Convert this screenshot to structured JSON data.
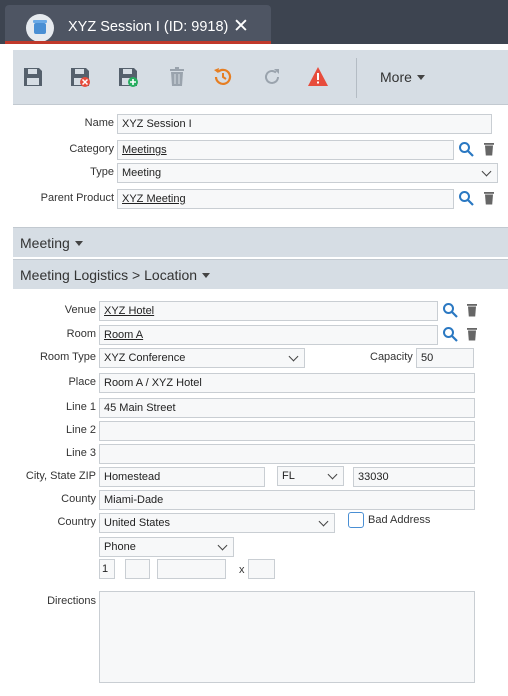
{
  "window": {
    "title": "XYZ Session I (ID: 9918)",
    "close_glyph": "✕"
  },
  "toolbar": {
    "buttons": [
      "save-icon",
      "save-close-icon",
      "save-new-icon",
      "delete-icon",
      "history-icon",
      "refresh-icon",
      "warning-icon"
    ],
    "more_label": "More",
    "colors": {
      "history": "#e67e22",
      "warning": "#e74c3c",
      "save_new_badge": "#27ae60",
      "save_close_badge": "#e74c3c"
    }
  },
  "header_form": {
    "name_label": "Name",
    "name_value": "XYZ Session I",
    "category_label": "Category",
    "category_value": "Meetings",
    "type_label": "Type",
    "type_value": "Meeting",
    "parent_label": "Parent Product",
    "parent_value": "XYZ Meeting"
  },
  "sections": {
    "meeting": "Meeting",
    "logistics": "Meeting Logistics > Location"
  },
  "location": {
    "venue_label": "Venue",
    "venue_value": "XYZ Hotel",
    "room_label": "Room",
    "room_value": "Room A",
    "room_type_label": "Room Type",
    "room_type_value": "XYZ Conference",
    "capacity_label": "Capacity",
    "capacity_value": "50",
    "place_label": "Place",
    "place_value": "Room A / XYZ Hotel",
    "line1_label": "Line 1",
    "line1_value": "45 Main Street",
    "line2_label": "Line 2",
    "line2_value": "",
    "line3_label": "Line 3",
    "line3_value": "",
    "city_label": "City, State ZIP",
    "city_value": "Homestead",
    "state_value": "FL",
    "zip_value": "33030",
    "county_label": "County",
    "county_value": "Miami-Dade",
    "country_label": "Country",
    "country_value": "United States",
    "bad_address_label": "Bad Address",
    "phone_type_value": "Phone",
    "phone_country_code": "1",
    "phone_ext_sep": "x",
    "directions_label": "Directions"
  }
}
